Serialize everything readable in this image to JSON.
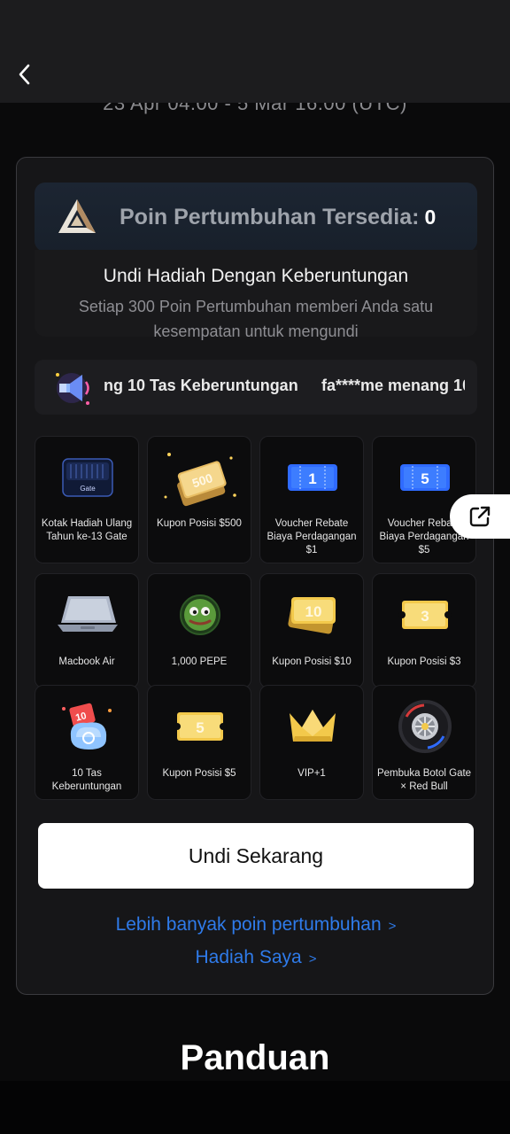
{
  "header": {
    "date_range": "23 Apr 04:00 - 5 Mar 16:00 (UTC)"
  },
  "points": {
    "label": "Poin Pertumbuhan Tersedia:",
    "value": "0"
  },
  "lottery": {
    "title": "Undi Hadiah Dengan Keberuntungan",
    "description": "Setiap 300 Poin Pertumbuhan memberi Anda satu kesempatan untuk mengundi"
  },
  "marquee": {
    "text_1": "ng 10 Tas Keberuntungan",
    "text_2": "fa****me menang 10"
  },
  "prizes": [
    {
      "label": "Kotak Hadiah Ulang Tahun ke-13 Gate",
      "icon": "gift-box-icon",
      "logo_text": "Gate"
    },
    {
      "label": "Kupon Posisi $500",
      "icon": "coupon-500-icon",
      "badge": "500"
    },
    {
      "label": "Voucher Rebate Biaya Perdagangan $1",
      "icon": "voucher-1-icon",
      "badge": "1"
    },
    {
      "label": "Voucher Rebate Biaya Perdagangan $5",
      "icon": "voucher-5-icon",
      "badge": "5"
    },
    {
      "label": "Macbook Air",
      "icon": "laptop-icon"
    },
    {
      "label": "1,000 PEPE",
      "icon": "pepe-coin-icon"
    },
    {
      "label": "Kupon Posisi $10",
      "icon": "coupon-10-icon",
      "badge": "10"
    },
    {
      "label": "Kupon Posisi $3",
      "icon": "coupon-3-icon",
      "badge": "3"
    },
    {
      "label": "10 Tas Keberuntungan",
      "icon": "lucky-bag-icon",
      "badge": "10"
    },
    {
      "label": "Kupon Posisi $5",
      "icon": "coupon-5-icon",
      "badge": "5"
    },
    {
      "label": "VIP+1",
      "icon": "crown-icon"
    },
    {
      "label": "Pembuka Botol Gate × Red Bull",
      "icon": "tire-bottle-opener-icon"
    }
  ],
  "actions": {
    "draw_label": "Undi Sekarang",
    "more_points_label": "Lebih banyak poin pertumbuhan",
    "my_prizes_label": "Hadiah Saya",
    "chevron": ">"
  },
  "guide": {
    "title": "Panduan"
  },
  "colors": {
    "accent_link": "#2f7bea",
    "card_bg": "#161618",
    "gold": "#f3c94b",
    "voucher_blue": "#2f6bff"
  }
}
